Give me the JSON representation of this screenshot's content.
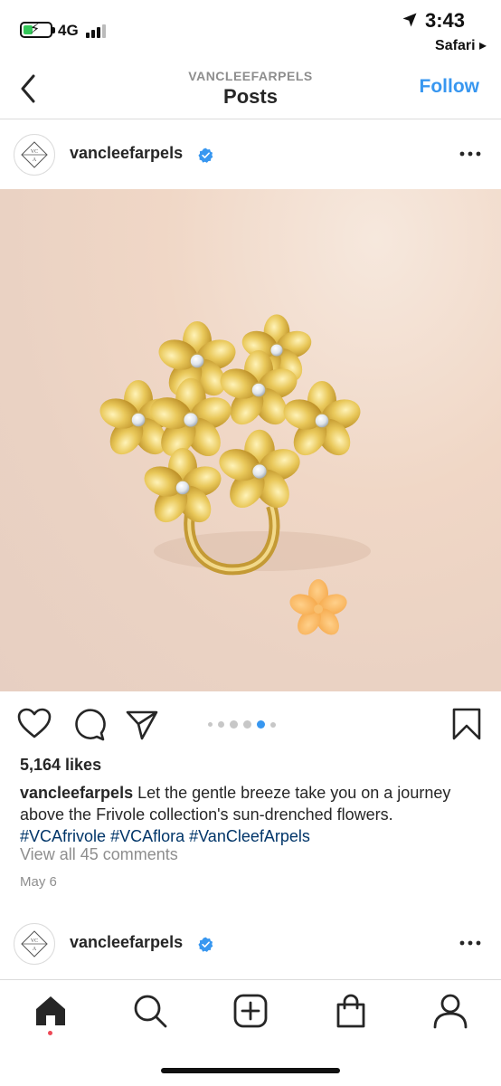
{
  "status_bar": {
    "network": "4G",
    "time": "3:43",
    "back_app": "Safari ▸"
  },
  "nav": {
    "subtitle": "VANCLEEFARPELS",
    "title": "Posts",
    "follow_label": "Follow"
  },
  "post": {
    "username": "vancleefarpels",
    "likes": "5,164 likes",
    "caption_user": "vancleefarpels",
    "caption_text": "Let the gentle breeze take you on a journey above the Frivole collection's sun-drenched flowers.",
    "hashtags": [
      "#VCAfrivole",
      "#VCAflora",
      "#VanCleefArpels"
    ],
    "view_comments": "View all 45 comments",
    "date": "May 6",
    "carousel_total": 6,
    "carousel_active": 5
  },
  "next_post": {
    "username": "vancleefarpels"
  },
  "tabbar": {
    "items": [
      "home-icon",
      "search-icon",
      "add-icon",
      "shop-icon",
      "profile-icon"
    ],
    "active": "home-icon"
  },
  "colors": {
    "accent": "#3897f0",
    "hashtag": "#003569",
    "muted": "#8e8e8e",
    "notification": "#ed4956"
  }
}
